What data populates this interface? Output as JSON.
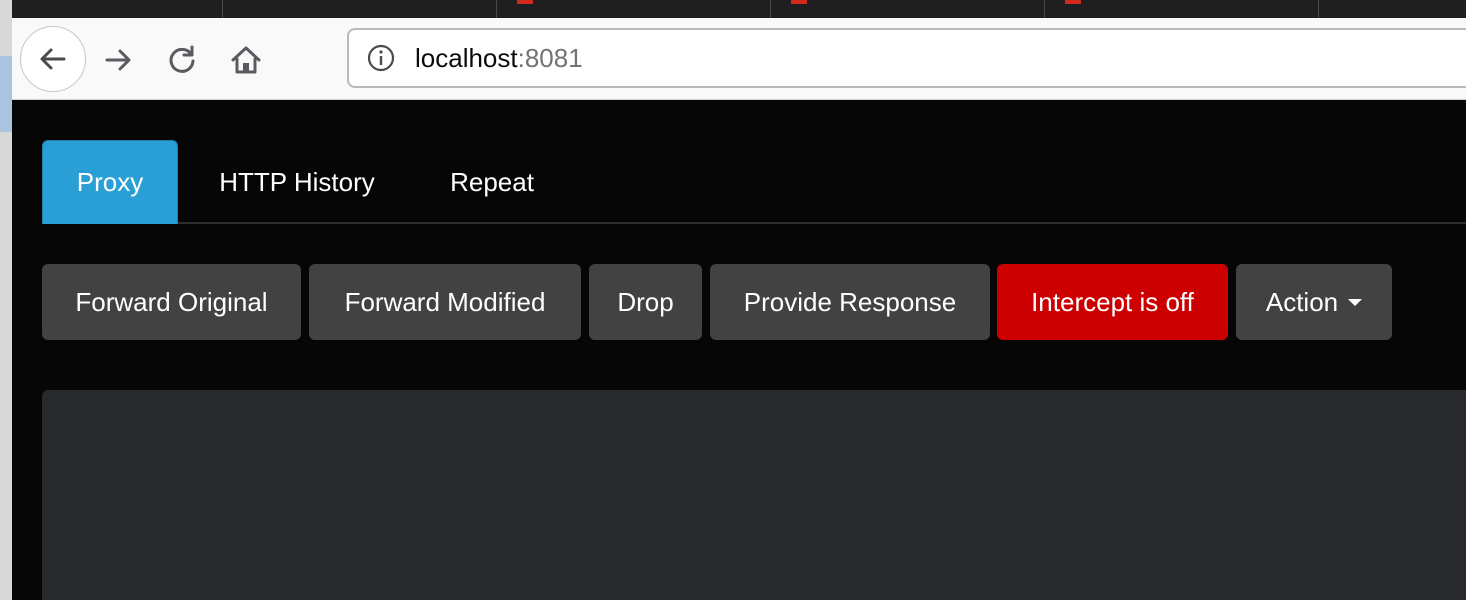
{
  "browser": {
    "url_host": "localhost",
    "url_port": ":8081",
    "icons": {
      "back": "back-arrow-icon",
      "forward": "forward-arrow-icon",
      "reload": "reload-icon",
      "home": "home-icon",
      "info": "info-icon"
    }
  },
  "app": {
    "tabs": [
      {
        "label": "Proxy",
        "active": true
      },
      {
        "label": "HTTP History",
        "active": false
      },
      {
        "label": "Repeat",
        "active": false
      }
    ],
    "toolbar": {
      "forward_original": "Forward Original",
      "forward_modified": "Forward Modified",
      "drop": "Drop",
      "provide_response": "Provide Response",
      "intercept": "Intercept is off",
      "action": "Action"
    },
    "colors": {
      "active_tab": "#2a9fd6",
      "intercept_button": "#cc0000",
      "button": "#424242",
      "background": "#060606",
      "editor_panel": "#27292c"
    }
  }
}
